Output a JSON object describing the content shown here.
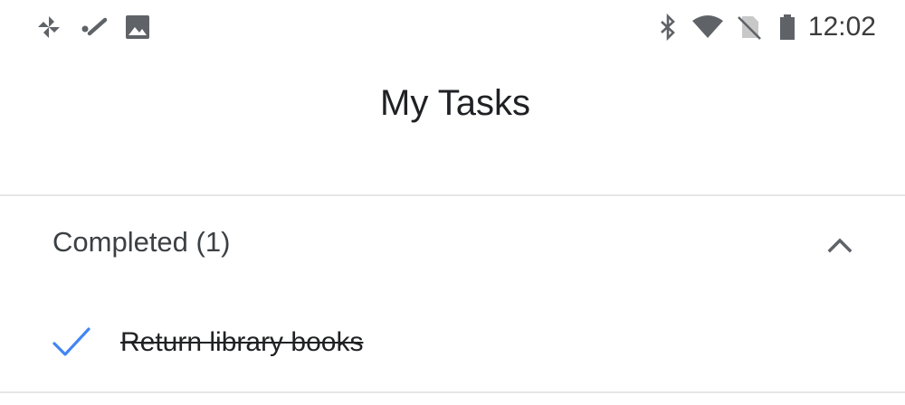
{
  "status_bar": {
    "time": "12:02",
    "left_icons": [
      "pinwheel-app-icon",
      "fit-app-icon",
      "image-icon"
    ],
    "right_icons": [
      "bluetooth-icon",
      "wifi-icon",
      "no-sim-icon",
      "battery-icon"
    ]
  },
  "header": {
    "title": "My Tasks"
  },
  "completed_section": {
    "label": "Completed (1)",
    "toggle_icon": "chevron-up-icon",
    "tasks": [
      {
        "title": "Return library books",
        "done": true,
        "icon": "checkmark-icon"
      }
    ]
  },
  "colors": {
    "accent": "#4285f4",
    "text": "#202124",
    "icon": "#5f6368",
    "divider": "#e6e6e6"
  }
}
